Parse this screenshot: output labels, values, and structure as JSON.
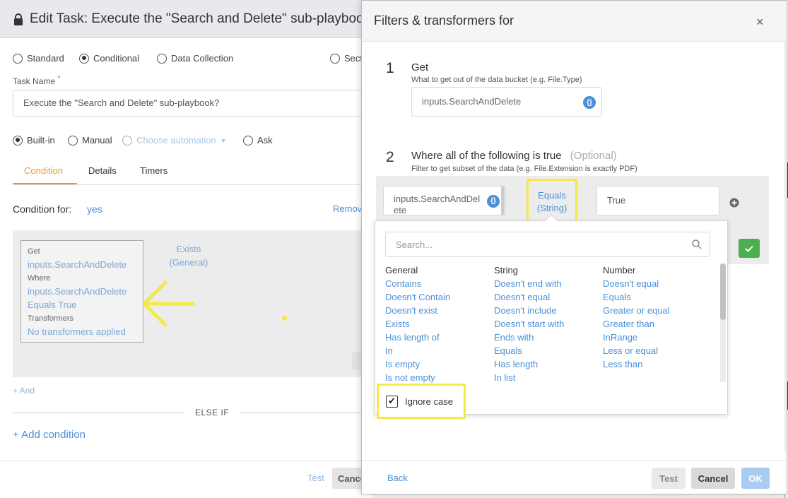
{
  "edit_task": {
    "title": "Edit Task: Execute the \"Search and Delete\" sub-playbook?",
    "task_types": [
      "Standard",
      "Conditional",
      "Data Collection",
      "Sect"
    ],
    "selected_task_type": "Conditional",
    "task_name_label": "Task Name",
    "required_mark": "*",
    "task_name_value": "Execute the \"Search and Delete\" sub-playbook?",
    "automation_types": [
      "Built-in",
      "Manual",
      "Choose automation",
      "Ask"
    ],
    "selected_automation_type": "Built-in",
    "tabs": [
      "Condition",
      "Details",
      "Timers"
    ],
    "active_tab": "Condition",
    "condition_for_label": "Condition for:",
    "condition_for_value": "yes",
    "remove_label": "Remov",
    "card": {
      "get_label": "Get",
      "get_value": "inputs.SearchAndDelete",
      "where_label": "Where",
      "where_value_1": "inputs.SearchAndDelete",
      "where_value_2": "Equals True",
      "transformers_label": "Transformers",
      "transformers_value": "No transformers applied"
    },
    "exists_label": "Exists",
    "general_label": "(General)",
    "and_label": "+ And",
    "else_if_label": "ELSE IF",
    "add_condition_label": "+ Add condition",
    "test_label": "Test",
    "cancel_label": "Cance"
  },
  "modal": {
    "title": "Filters & transformers for",
    "close": "×",
    "step1": {
      "num": "1",
      "title": "Get",
      "subtitle": "What to get out of the data bucket (e.g. File.Type)",
      "value": "inputs.SearchAndDelete"
    },
    "step2": {
      "num": "2",
      "title": "Where all of the following is true",
      "optional": "(Optional)",
      "subtitle": "Filter to get subset of the data (e.g. File.Extension is exactly PDF)",
      "left_line1": "inputs.SearchAndDel",
      "left_line2": "ete",
      "operator_line1": "Equals",
      "operator_line2": "(String)",
      "value": "True"
    },
    "brace_icon": "{}",
    "dropdown": {
      "search_placeholder": "Search...",
      "columns": [
        {
          "header": "General",
          "options": [
            "Contains",
            "Doesn't Contain",
            "Doesn't exist",
            "Exists",
            "Has length of",
            "In",
            "Is empty",
            "Is not empty"
          ]
        },
        {
          "header": "String",
          "options": [
            "Doesn't end with",
            "Doesn't equal",
            "Doesn't include",
            "Doesn't start with",
            "Ends with",
            "Equals",
            "Has length",
            "In list"
          ]
        },
        {
          "header": "Number",
          "options": [
            "Doesn't equal",
            "Equals",
            "Greater or equal",
            "Greater than",
            "InRange",
            "Less or equal",
            "Less than"
          ]
        }
      ],
      "ignore_case_label": "Ignore case",
      "ignore_case_checked": true
    },
    "back_label": "Back",
    "test_label": "Test",
    "cancel_label": "Cancel",
    "ok_label": "OK"
  },
  "colors": {
    "accent_link": "#4a90d9",
    "tab_active": "#e89a2c",
    "highlight": "#f7e84a",
    "ok_green": "#4caf50"
  }
}
